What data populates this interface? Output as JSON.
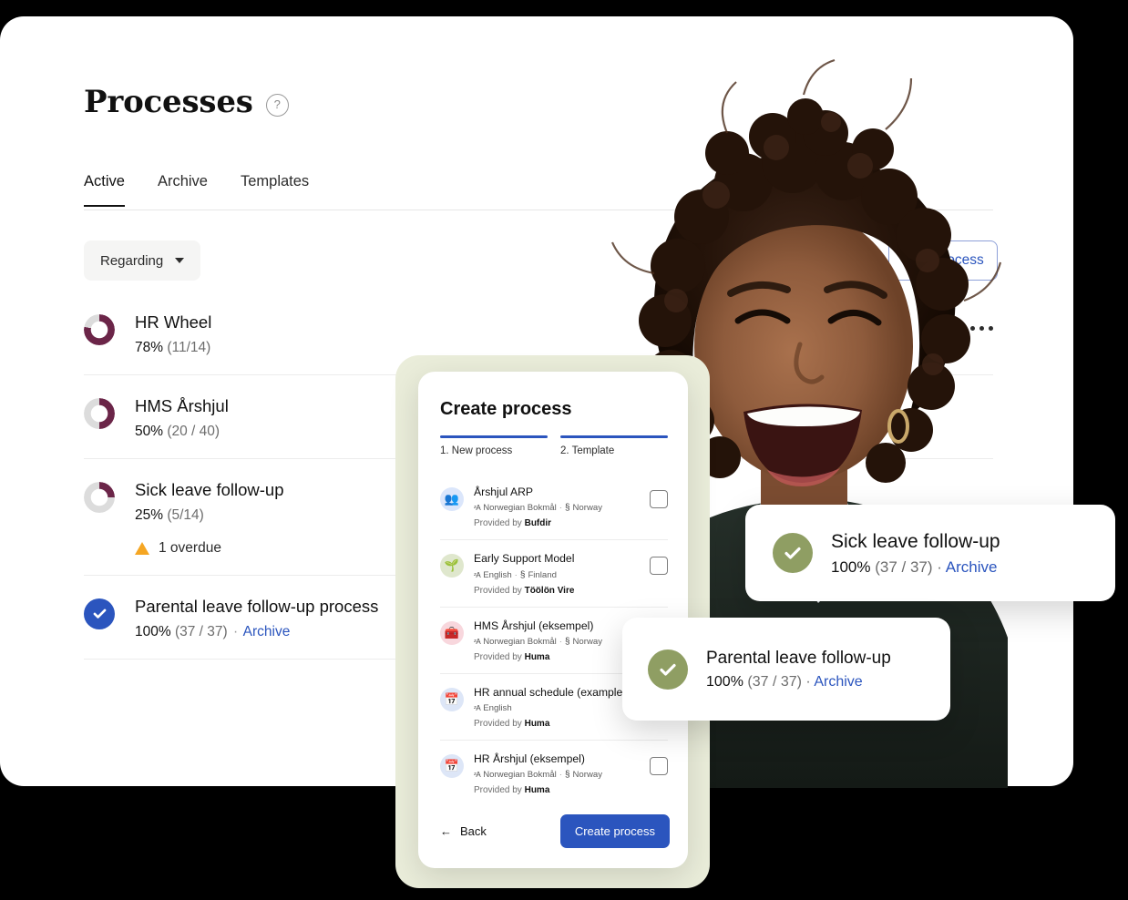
{
  "page": {
    "title": "Processes",
    "help_icon": "question-mark-icon"
  },
  "tabs": [
    {
      "label": "Active",
      "active": true
    },
    {
      "label": "Archive",
      "active": false
    },
    {
      "label": "Templates",
      "active": false
    }
  ],
  "toolbar": {
    "filter_label": "Regarding",
    "filter_caret": "chevron-down-icon",
    "new_process_label": "New process",
    "kebab": "more-options-icon"
  },
  "processes": [
    {
      "name": "HR Wheel",
      "percent_label": "78%",
      "count_label": "(11/14)",
      "progress": 78,
      "complete": false,
      "overdue": null,
      "archive": null
    },
    {
      "name": "HMS Årshjul",
      "percent_label": "50%",
      "count_label": "(20 / 40)",
      "progress": 50,
      "complete": false,
      "overdue": null,
      "archive": null
    },
    {
      "name": "Sick leave follow-up",
      "percent_label": "25%",
      "count_label": "(5/14)",
      "progress": 25,
      "complete": false,
      "overdue": "1 overdue",
      "archive": null
    },
    {
      "name": "Parental leave follow-up process",
      "percent_label": "100%",
      "count_label": "(37 / 37)",
      "progress": 100,
      "complete": true,
      "overdue": null,
      "archive": "Archive"
    }
  ],
  "modal": {
    "title": "Create process",
    "steps": [
      {
        "label": "1. New process"
      },
      {
        "label": "2. Template"
      }
    ],
    "templates": [
      {
        "name": "Årshjul ARP",
        "language": "Norwegian Bokmål",
        "country": "Norway",
        "provided_prefix": "Provided by",
        "provider": "Bufdir",
        "icon": "people-icon",
        "icon_glyph": "👥",
        "icon_bg": "#dbe6fb"
      },
      {
        "name": "Early Support Model",
        "language": "English",
        "country": "Finland",
        "provided_prefix": "Provided by",
        "provider": "Töölön Vire",
        "icon": "seedling-icon",
        "icon_glyph": "🌱",
        "icon_bg": "#dfe7cd"
      },
      {
        "name": "HMS Årshjul (eksempel)",
        "language": "Norwegian Bokmål",
        "country": "Norway",
        "provided_prefix": "Provided by",
        "provider": "Huma",
        "icon": "toolbox-icon",
        "icon_glyph": "🧰",
        "icon_bg": "#f8d7dd"
      },
      {
        "name": "HR annual schedule (example)",
        "language": "English",
        "country": "",
        "provided_prefix": "Provided by",
        "provider": "Huma",
        "icon": "calendar-icon",
        "icon_glyph": "📅",
        "icon_bg": "#dde6f7"
      },
      {
        "name": "HR Årshjul (eksempel)",
        "language": "Norwegian Bokmål",
        "country": "Norway",
        "provided_prefix": "Provided by",
        "provider": "Huma",
        "icon": "calendar-icon",
        "icon_glyph": "📅",
        "icon_bg": "#dde6f7"
      }
    ],
    "back_label": "Back",
    "back_icon": "arrow-left-icon",
    "create_label": "Create process",
    "lang_glyph": "ᶻA",
    "section_glyph": "§",
    "separator": "·"
  },
  "toasts": [
    {
      "title": "Sick leave follow-up",
      "percent_label": "100%",
      "count_label": "(37 / 37)",
      "separator": "·",
      "archive": "Archive",
      "icon": "check-circle-icon"
    },
    {
      "title": "Parental leave follow-up",
      "percent_label": "100%",
      "count_label": "(37 / 37)",
      "separator": "·",
      "archive": "Archive",
      "icon": "check-circle-icon"
    }
  ],
  "colors": {
    "progress_ring": "#6b2548",
    "ring_track": "#dcdcdc",
    "accent_blue": "#2b55be",
    "toast_green": "#8f9e63",
    "warning": "#f5a623",
    "modal_frame": "#eaedda"
  },
  "photo": {
    "alt": "smiling-woman-photo"
  }
}
